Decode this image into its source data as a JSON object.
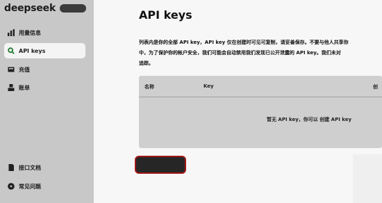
{
  "sidebar": {
    "brand": "deepseek",
    "items": [
      {
        "label": "用量信息",
        "icon": "bar-chart-icon"
      },
      {
        "label": "API keys",
        "icon": "search-icon",
        "active": true
      },
      {
        "label": "充值",
        "icon": "wallet-icon"
      },
      {
        "label": "账单",
        "icon": "person-icon"
      }
    ],
    "bottom_items": [
      {
        "label": "接口文档",
        "icon": "document-icon"
      },
      {
        "label": "常见问题",
        "icon": "help-icon"
      }
    ]
  },
  "main": {
    "title": "API keys",
    "description_line1": "列表内是你的全部 API key，API key 仅在创建时可见可复制，请妥善保存。不要与他人共享你",
    "description_line2": "中，为了保护你的帐户安全，我们可能会自动禁用我们发现已公开泄露的 API key。我们未对",
    "description_line3": "追踪。",
    "table": {
      "columns": [
        "名称",
        "Key",
        "创"
      ],
      "empty_text": "暂无 API key，你可以 创建 API key"
    },
    "create_button": ""
  },
  "colors": {
    "sidebar_bg": "#c8c8c8",
    "button_bg": "#262626",
    "button_border": "#a01818"
  }
}
